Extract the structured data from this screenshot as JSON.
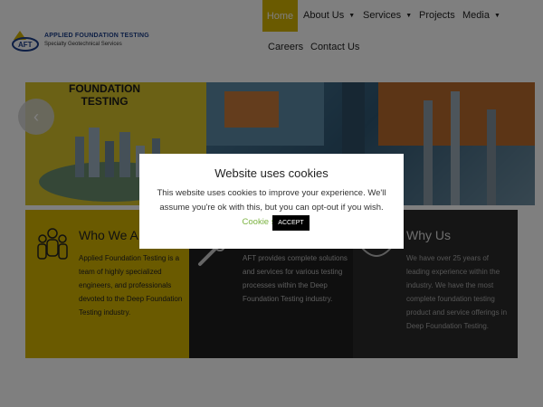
{
  "header": {
    "logo_title": "APPLIED FOUNDATION TESTING",
    "logo_subtitle": "Specialty Geotechnical Services",
    "logo_badge": "AFT",
    "nav": [
      {
        "label": "Home",
        "active": true
      },
      {
        "label": "About Us",
        "has_dropdown": true
      },
      {
        "label": "Services",
        "has_dropdown": true
      },
      {
        "label": "Projects"
      },
      {
        "label": "Media",
        "has_dropdown": true
      },
      {
        "label": "Careers"
      },
      {
        "label": "Contact Us"
      }
    ]
  },
  "hero": {
    "title_line1": "FOUNDATION",
    "title_line2": "TESTING",
    "prev_icon": "chevron-left-icon"
  },
  "cards": [
    {
      "title": "Who We A",
      "body": "Applied Foundation Testing is a team of highly specialized engineers, and professionals devoted to the Deep Foundation Testing industry.",
      "icon": "team-icon",
      "bg": "#d4b400"
    },
    {
      "title": "",
      "body": "AFT provides complete solutions and services for various testing processes within the Deep Foundation Testing industry.",
      "icon": "tools-icon",
      "bg": "#1e1e1e"
    },
    {
      "title": "Why Us",
      "body": "We have over 25 years of leading experience within the industry. We have the most complete foundation testing product and service offerings in Deep Foundation Testing.",
      "icon": "shield-icon",
      "bg": "#2a2a2a"
    }
  ],
  "cookie": {
    "title": "Website uses cookies",
    "message": "This website uses cookies to improve your experience. We'll assume you're ok with this, but you can opt-out if you wish.",
    "settings_link": "Cookie settings",
    "accept_label": "ACCEPT"
  },
  "colors": {
    "accent": "#d4b400",
    "link_green": "#7cb342"
  }
}
